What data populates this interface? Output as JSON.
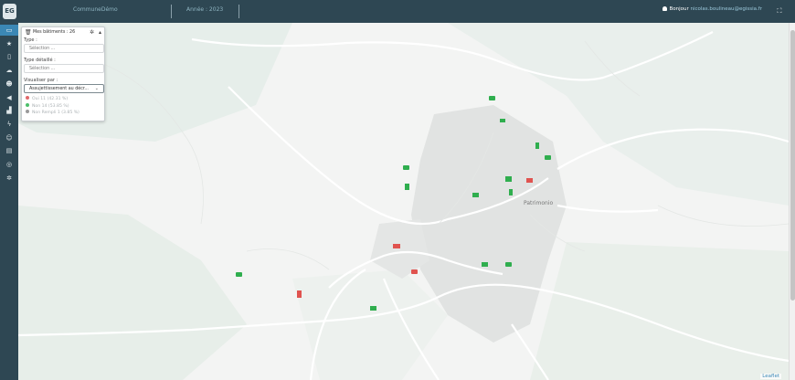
{
  "topbar": {
    "logo": "EG",
    "commune": "CommuneDémo",
    "year": "Année : 2023",
    "greeting": "Bonjour",
    "email": "nicolas.boulineau@egissia.fr"
  },
  "sidebar": {
    "items": [
      {
        "icon": "map-icon",
        "glyph": "▭",
        "active": true
      },
      {
        "icon": "star-icon",
        "glyph": "★"
      },
      {
        "icon": "document-icon",
        "glyph": "▯"
      },
      {
        "icon": "cloud-icon",
        "glyph": "☁"
      },
      {
        "icon": "users-icon",
        "glyph": "☻"
      },
      {
        "icon": "speaker-icon",
        "glyph": "◀"
      },
      {
        "icon": "chart-icon",
        "glyph": "▟"
      },
      {
        "icon": "bolt-icon",
        "glyph": "ϟ"
      },
      {
        "icon": "group-icon",
        "glyph": "☺"
      },
      {
        "icon": "calendar-icon",
        "glyph": "▤"
      },
      {
        "icon": "target-icon",
        "glyph": "◎"
      },
      {
        "icon": "gear-icon",
        "glyph": "✲"
      }
    ]
  },
  "panel": {
    "title": "Mes bâtiments : 26",
    "type_label": "Type :",
    "type_placeholder": "Sélection ...",
    "detail_label": "Type détaillé :",
    "detail_placeholder": "Sélection ...",
    "visualize_label": "Visualiser par :",
    "visualize_value": "Assujettissement au décr...",
    "legend": [
      {
        "label": "Oui 11 (42.31 %)",
        "color": "#e0696b"
      },
      {
        "label": "Non 14 (53.85 %)",
        "color": "#4cbf6a"
      },
      {
        "label": "Non Rempli 1 (3.85 %)",
        "color": "#9a9a9a"
      }
    ]
  },
  "map": {
    "place_label": "Patrimonio",
    "attribution": "Leaflet",
    "colors": {
      "oui": "#e0534f",
      "non": "#2fae4e"
    }
  }
}
